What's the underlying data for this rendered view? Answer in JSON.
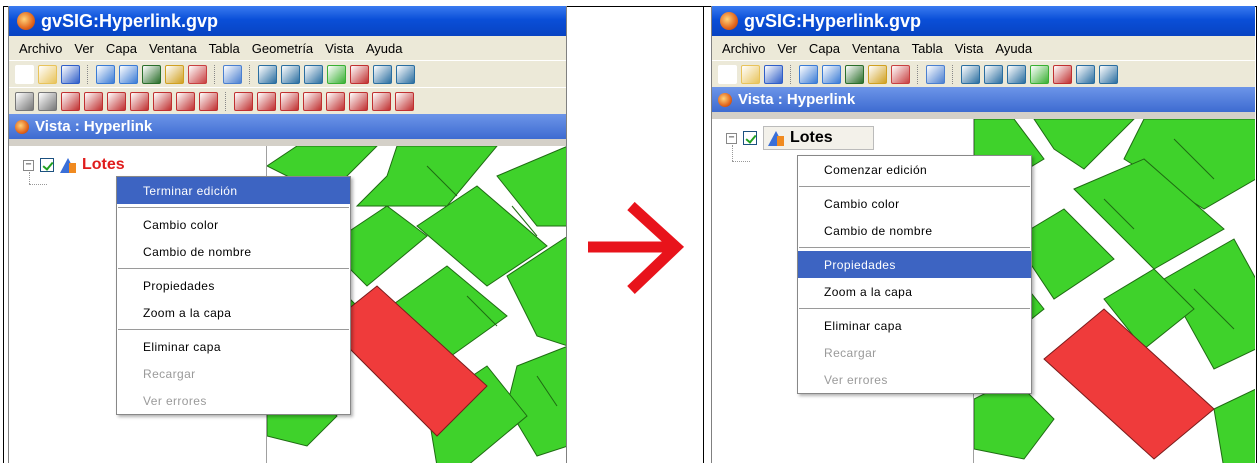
{
  "left": {
    "app_title": "gvSIG:Hyperlink.gvp",
    "menu": [
      "Archivo",
      "Ver",
      "Capa",
      "Ventana",
      "Tabla",
      "Geometría",
      "Vista",
      "Ayuda"
    ],
    "view_title": "Vista : Hyperlink",
    "layer": {
      "name": "Lotes",
      "name_color": "#e01c1c"
    },
    "context_menu": [
      {
        "label": "Terminar edición",
        "state": "highlighted"
      },
      {
        "label": "Cambio color",
        "state": "normal"
      },
      {
        "label": "Cambio de nombre",
        "state": "normal"
      },
      {
        "label": "Propiedades",
        "state": "normal"
      },
      {
        "label": "Zoom a la capa",
        "state": "normal"
      },
      {
        "label": "Eliminar capa",
        "state": "normal"
      },
      {
        "label": "Recargar",
        "state": "disabled"
      },
      {
        "label": "Ver errores",
        "state": "disabled"
      }
    ]
  },
  "right": {
    "app_title": "gvSIG:Hyperlink.gvp",
    "menu": [
      "Archivo",
      "Ver",
      "Capa",
      "Ventana",
      "Tabla",
      "Vista",
      "Ayuda"
    ],
    "view_title": "Vista : Hyperlink",
    "layer": {
      "name": "Lotes",
      "name_color": "#000000"
    },
    "context_menu": [
      {
        "label": "Comenzar edición",
        "state": "normal"
      },
      {
        "label": "Cambio color",
        "state": "normal"
      },
      {
        "label": "Cambio de nombre",
        "state": "normal"
      },
      {
        "label": "Propiedades",
        "state": "highlighted"
      },
      {
        "label": "Zoom a la capa",
        "state": "normal"
      },
      {
        "label": "Eliminar capa",
        "state": "normal"
      },
      {
        "label": "Recargar",
        "state": "disabled"
      },
      {
        "label": "Ver errores",
        "state": "disabled"
      }
    ]
  },
  "colors": {
    "parcel": "#3fd22b",
    "selected_parcel": "#ef3b3b",
    "arrow": "#e8131b",
    "highlight": "#3d64c2"
  },
  "icons": [
    "gvsig-logo-icon",
    "new-icon",
    "open-icon",
    "save-icon",
    "zoom-in-icon",
    "zoom-out-icon",
    "pan-icon",
    "arrow-right-icon"
  ]
}
